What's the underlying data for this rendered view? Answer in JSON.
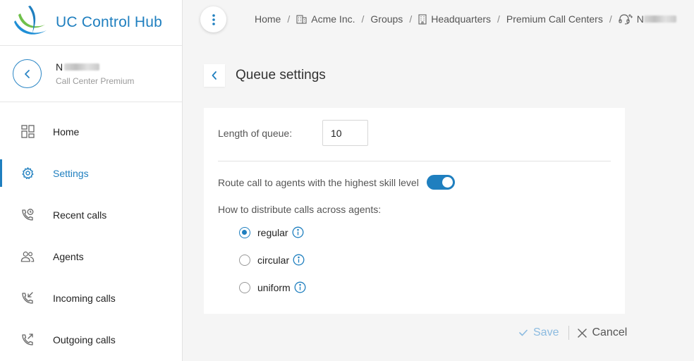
{
  "brand": {
    "name": "UC Control Hub"
  },
  "entity": {
    "name_prefix": "N",
    "subtitle": "Call Center Premium"
  },
  "nav": [
    {
      "label": "Home",
      "icon": "dashboard-icon"
    },
    {
      "label": "Settings",
      "icon": "gear-icon",
      "active": true
    },
    {
      "label": "Recent calls",
      "icon": "phone-clock-icon"
    },
    {
      "label": "Agents",
      "icon": "agents-icon"
    },
    {
      "label": "Incoming calls",
      "icon": "incoming-call-icon"
    },
    {
      "label": "Outgoing calls",
      "icon": "outgoing-call-icon"
    }
  ],
  "breadcrumb": {
    "home": "Home",
    "company": "Acme Inc.",
    "groups": "Groups",
    "group": "Headquarters",
    "section": "Premium Call Centers",
    "current_prefix": "N"
  },
  "page": {
    "title": "Queue settings"
  },
  "form": {
    "queue_length_label": "Length of queue:",
    "queue_length_value": "10",
    "skill_route_label": "Route call to agents with the highest skill level",
    "skill_route_enabled": true,
    "distribution_label": "How to distribute calls across agents:",
    "distribution_options": [
      {
        "label": "regular",
        "checked": true
      },
      {
        "label": "circular",
        "checked": false
      },
      {
        "label": "uniform",
        "checked": false
      }
    ]
  },
  "actions": {
    "save_label": "Save",
    "cancel_label": "Cancel"
  },
  "colors": {
    "accent": "#1f7fbf",
    "save_disabled": "#8cbbe0",
    "background": "#f5f5f5"
  }
}
